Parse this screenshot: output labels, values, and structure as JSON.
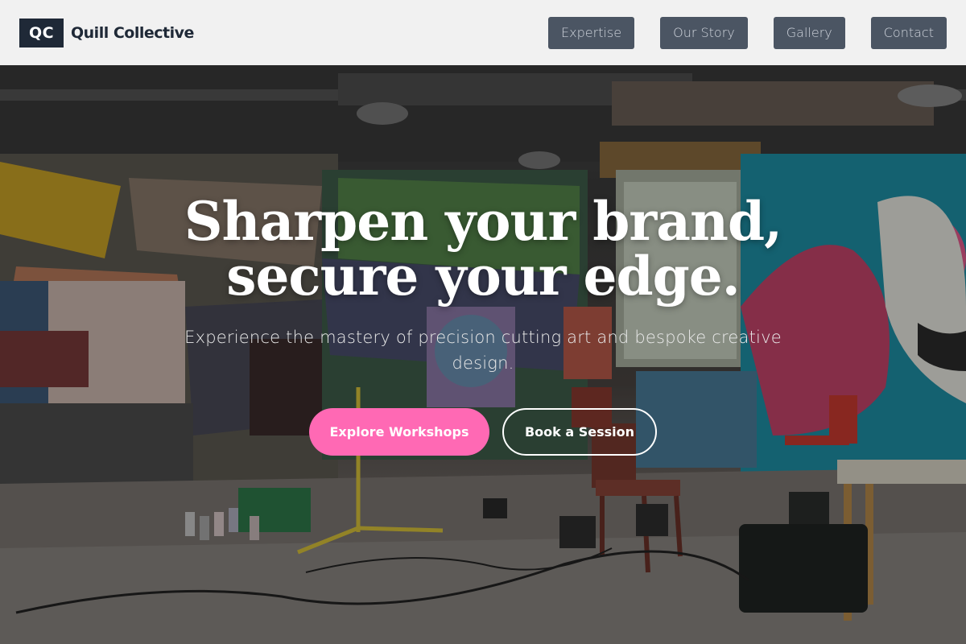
{
  "brand": {
    "mark": "QC",
    "name": "Quill Collective"
  },
  "nav": {
    "items": [
      {
        "label": "Expertise"
      },
      {
        "label": "Our Story"
      },
      {
        "label": "Gallery"
      },
      {
        "label": "Contact"
      }
    ]
  },
  "hero": {
    "headline_line1": "Sharpen your brand,",
    "headline_line2": "secure your edge.",
    "subheading": "Experience the mastery of precision cutting art and bespoke creative design.",
    "background_image": "graffiti art studio with easels, chairs and spray cans",
    "primary_cta": "Explore Workshops",
    "secondary_cta": "Book a Session"
  },
  "colors": {
    "header_bg": "#f1f1f1",
    "logo_bg": "#1f2937",
    "nav_button_bg": "#4b5563",
    "primary_cta": "#ff69b4"
  }
}
